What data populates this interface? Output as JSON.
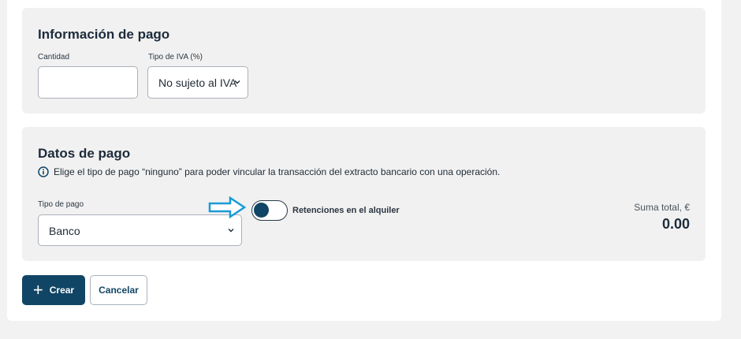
{
  "payment_info": {
    "title": "Información de pago",
    "amount_label": "Cantidad",
    "amount_value": "",
    "vat_label": "Tipo de IVA (%)",
    "vat_selected": "No sujeto al IVA"
  },
  "payment_data": {
    "title": "Datos de pago",
    "info_text": "Elige el tipo de pago “ninguno” para poder vincular la transacción del extracto bancario con una operación.",
    "payment_type_label": "Tipo de pago",
    "payment_type_selected": "Banco",
    "withholding_toggle_label": "Retenciones en el alquiler",
    "total_label": "Suma total, €",
    "total_value": "0.00"
  },
  "actions": {
    "create_label": "Crear",
    "create_icon": "plus-icon",
    "cancel_label": "Cancelar"
  },
  "colors": {
    "primary": "#114565",
    "annotation_arrow": "#1a9ad6",
    "section_bg": "#f1f1f1"
  }
}
